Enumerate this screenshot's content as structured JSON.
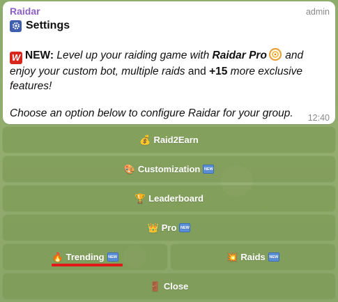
{
  "message": {
    "sender": "Raidar",
    "role": "admin",
    "title": "Settings",
    "new_label": "NEW:",
    "line1": "Level up your raiding game with",
    "pro_name": "Raidar Pro",
    "line1_end": "and",
    "line2_italic": "enjoy your custom bot, multiple raids",
    "line2_and": "and",
    "plus_count": "+15",
    "line2_end": "more exclusive",
    "line3": "features!",
    "footer": "Choose an option below to configure Raidar for your group.",
    "time": "12:40"
  },
  "keyboard": {
    "raid2earn": "Raid2Earn",
    "customization": "Customization",
    "leaderboard": "Leaderboard",
    "pro": "Pro",
    "trending": "Trending",
    "raids": "Raids",
    "close": "Close",
    "new_badge": "NEW"
  },
  "colors": {
    "sender": "#8e5fc9",
    "new_badge": "#5b8fd8",
    "highlight_underline": "#e01818",
    "button_bg": "#7c9a55"
  },
  "icons": {
    "title": "gear-icon",
    "raid2earn": "money-bag-icon",
    "customization": "palette-icon",
    "leaderboard": "trophy-icon",
    "pro": "crown-icon",
    "trending": "fire-icon",
    "raids": "explosion-icon",
    "close": "door-icon"
  }
}
